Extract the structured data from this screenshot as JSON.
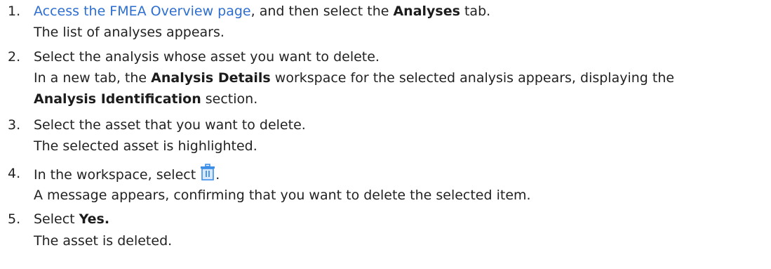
{
  "steps": [
    {
      "number": "1.",
      "link_text": "Access the FMEA Overview page",
      "text_a": ", and then select the ",
      "bold_a": "Analyses",
      "text_b": " tab.",
      "result": "The list of analyses appears."
    },
    {
      "number": "2.",
      "action": "Select the analysis whose asset you want to delete.",
      "result_a": "In a new tab, the ",
      "bold_a": "Analysis Details",
      "result_b": " workspace for the selected analysis appears, displaying the",
      "bold_b": "Analysis Identification",
      "result_c": " section."
    },
    {
      "number": "3.",
      "action": "Select the asset that you want to delete.",
      "result": "The selected asset is highlighted."
    },
    {
      "number": "4.",
      "action_a": "In the workspace, select ",
      "icon": "trash-icon",
      "action_b": ".",
      "result": "A message appears, confirming that you want to delete the selected item."
    },
    {
      "number": "5.",
      "action_a": "Select ",
      "bold_a": "Yes.",
      "result": "The asset is deleted."
    }
  ],
  "colors": {
    "link": "#2d6ecf",
    "text": "#222222",
    "icon": "#3a8ee6"
  }
}
